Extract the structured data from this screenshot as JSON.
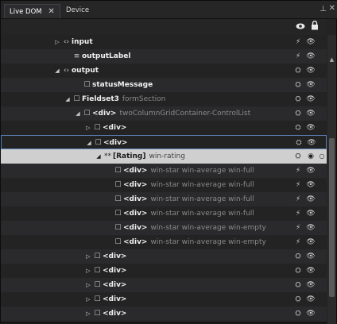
{
  "tabs": [
    {
      "label": "Live DOM",
      "close": "✕"
    },
    {
      "label": "Device"
    }
  ],
  "header": {
    "pin": "⊥",
    "overflow": "✕"
  },
  "tree": [
    {
      "exp": "▷",
      "icon": "‹›",
      "tag": "input",
      "cls": "",
      "r1": "⚡",
      "r2": "👁",
      "depth": 0
    },
    {
      "exp": "",
      "icon": "≡",
      "tag": "outputLabel",
      "cls": "",
      "r1": "⚡",
      "r2": "👁",
      "depth": 1
    },
    {
      "exp": "◢",
      "icon": "‹›",
      "tag": "output",
      "cls": "",
      "r1": "⛭",
      "r2": "👁",
      "depth": 0
    },
    {
      "exp": "",
      "icon": "☐",
      "tag": "statusMessage",
      "cls": "",
      "r1": "⛭",
      "r2": "👁",
      "depth": 2
    },
    {
      "exp": "◢",
      "icon": "☐",
      "tag": "Fieldset3",
      "cls": "formSection",
      "r1": "⛭",
      "r2": "👁",
      "depth": 1
    },
    {
      "exp": "◢",
      "icon": "☐",
      "tag": "<div>",
      "cls": "twoColumnGridContainer-ControlList",
      "r1": "⛭",
      "r2": "👁",
      "depth": 2
    },
    {
      "exp": "▷",
      "icon": "☐",
      "tag": "<div>",
      "cls": "",
      "r1": "⛭",
      "r2": "👁",
      "depth": 3
    },
    {
      "exp": "◢",
      "icon": "☐",
      "tag": "<div>",
      "cls": "",
      "r1": "⛭",
      "r2": "👁",
      "depth": 3,
      "state": "focus"
    },
    {
      "exp": "◢",
      "icon": "**",
      "tag": "[Rating]",
      "cls": "win-rating",
      "r1": "⛭",
      "r2": "◉",
      "r3": "○",
      "depth": 4,
      "state": "selected"
    },
    {
      "exp": "",
      "icon": "☐",
      "tag": "<div>",
      "cls": "win-star win-average win-full",
      "r1": "⚡",
      "r2": "👁",
      "depth": 5
    },
    {
      "exp": "",
      "icon": "☐",
      "tag": "<div>",
      "cls": "win-star win-average win-full",
      "r1": "⚡",
      "r2": "👁",
      "depth": 5
    },
    {
      "exp": "",
      "icon": "☐",
      "tag": "<div>",
      "cls": "win-star win-average win-full",
      "r1": "⚡",
      "r2": "👁",
      "depth": 5
    },
    {
      "exp": "",
      "icon": "☐",
      "tag": "<div>",
      "cls": "win-star win-average win-full",
      "r1": "⚡",
      "r2": "👁",
      "depth": 5
    },
    {
      "exp": "",
      "icon": "☐",
      "tag": "<div>",
      "cls": "win-star win-average win-empty",
      "r1": "⚡",
      "r2": "👁",
      "depth": 5
    },
    {
      "exp": "",
      "icon": "☐",
      "tag": "<div>",
      "cls": "win-star win-average win-empty",
      "r1": "⚡",
      "r2": "👁",
      "depth": 5
    },
    {
      "exp": "▷",
      "icon": "☐",
      "tag": "<div>",
      "cls": "",
      "r1": "⛭",
      "r2": "👁",
      "depth": 3
    },
    {
      "exp": "▷",
      "icon": "☐",
      "tag": "<div>",
      "cls": "",
      "r1": "⛭",
      "r2": "👁",
      "depth": 3
    },
    {
      "exp": "▷",
      "icon": "☐",
      "tag": "<div>",
      "cls": "",
      "r1": "⛭",
      "r2": "👁",
      "depth": 3
    },
    {
      "exp": "▷",
      "icon": "☐",
      "tag": "<div>",
      "cls": "",
      "r1": "⛭",
      "r2": "👁",
      "depth": 3
    },
    {
      "exp": "▷",
      "icon": "☐",
      "tag": "<div>",
      "cls": "",
      "r1": "⛭",
      "r2": "👁",
      "depth": 3
    },
    {
      "exp": "▷",
      "icon": "☐",
      "tag": "<div>",
      "cls": "",
      "r1": "⛭",
      "r2": "👁",
      "depth": 3
    }
  ]
}
